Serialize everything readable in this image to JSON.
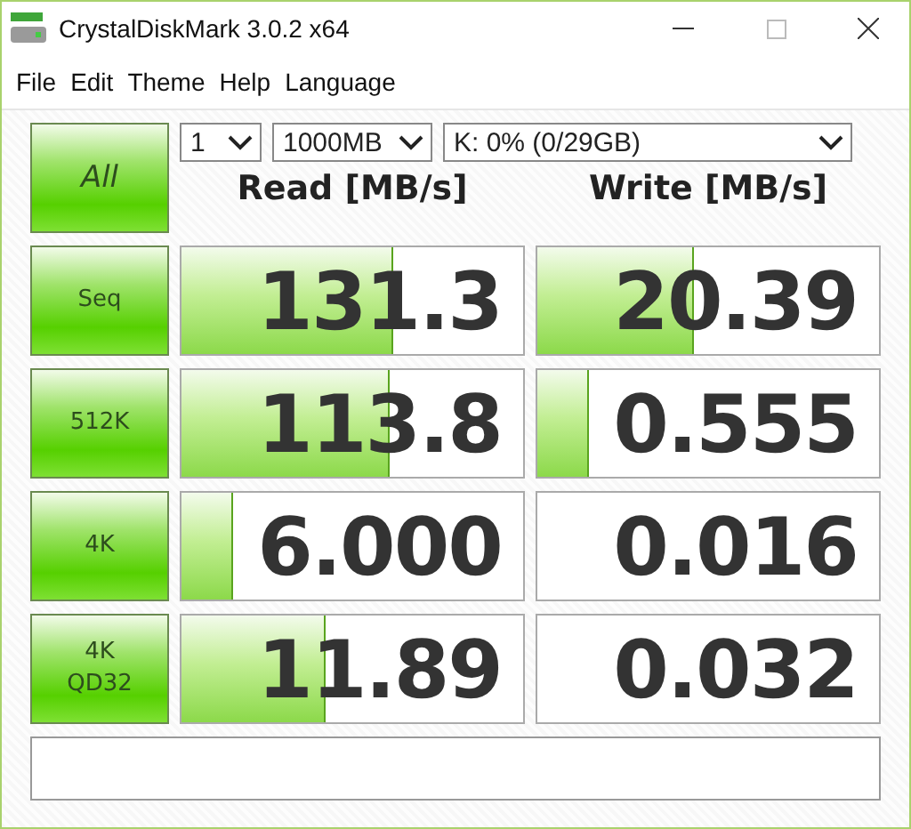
{
  "window": {
    "title": "CrystalDiskMark 3.0.2 x64"
  },
  "menu": [
    "File",
    "Edit",
    "Theme",
    "Help",
    "Language"
  ],
  "controls": {
    "all_button": "All",
    "count": "1",
    "size": "1000MB",
    "drive": "K: 0% (0/29GB)"
  },
  "columns": [
    "Read [MB/s]",
    "Write [MB/s]"
  ],
  "rows": [
    {
      "label": [
        "Seq"
      ],
      "read": {
        "value": "131.3",
        "level": 0.62
      },
      "write": {
        "value": "20.39",
        "level": 0.46
      }
    },
    {
      "label": [
        "512K"
      ],
      "read": {
        "value": "113.8",
        "level": 0.61
      },
      "write": {
        "value": "0.555",
        "level": 0.15
      }
    },
    {
      "label": [
        "4K"
      ],
      "read": {
        "value": "6.000",
        "level": 0.15
      },
      "write": {
        "value": "0.016"
      }
    },
    {
      "label": [
        "4K",
        "QD32"
      ],
      "read": {
        "value": "11.89",
        "level": 0.42
      },
      "write": {
        "value": "0.032"
      }
    }
  ]
}
